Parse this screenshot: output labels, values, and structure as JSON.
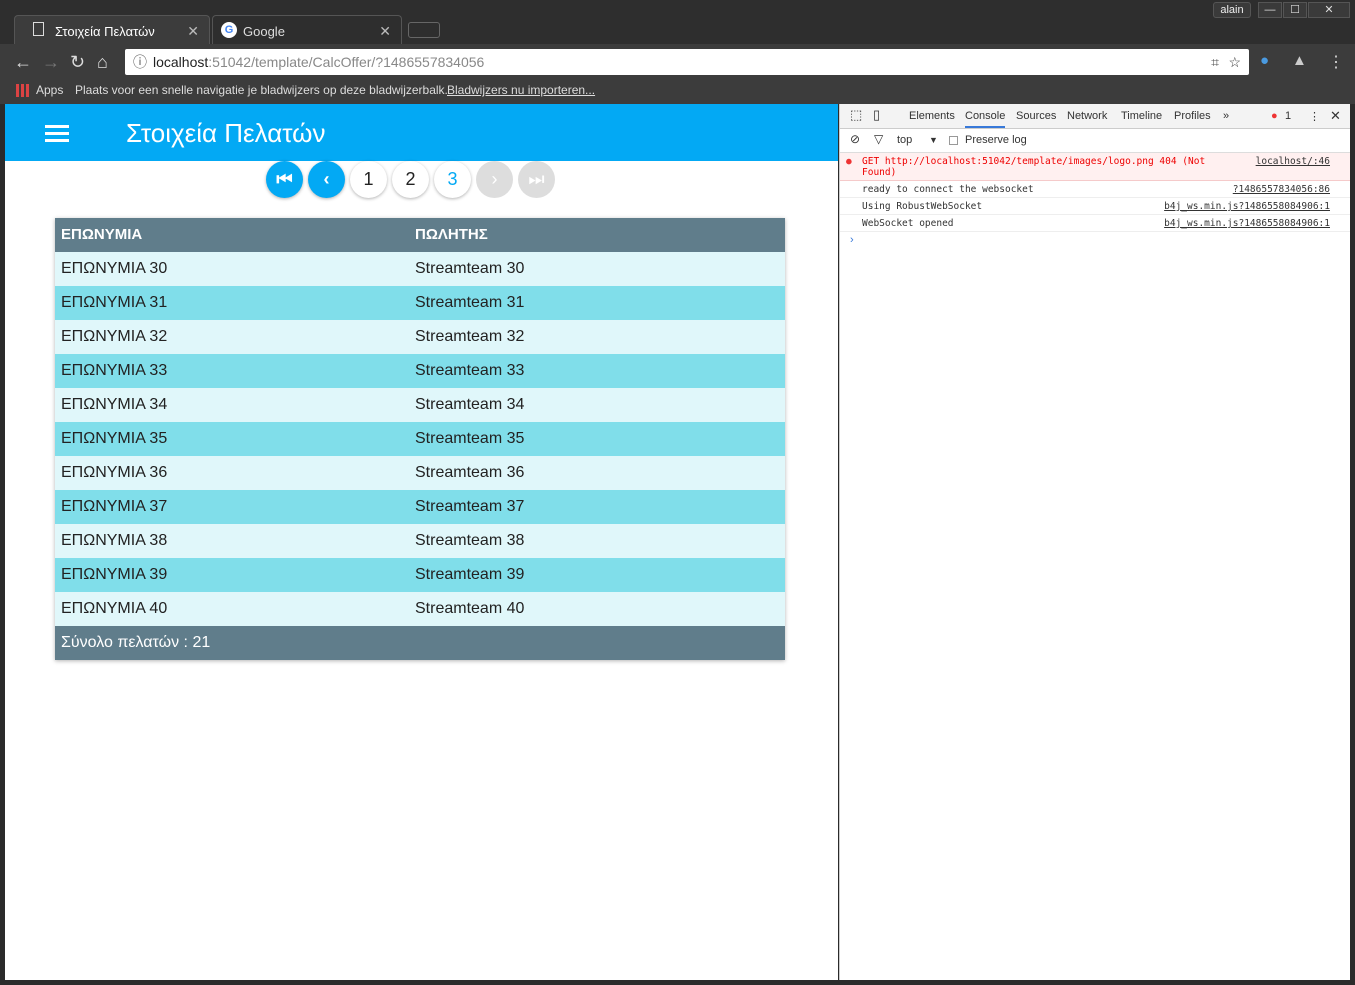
{
  "browser": {
    "tabs": [
      {
        "title": "Στοιχεία Πελατών",
        "icon": "page-icon"
      },
      {
        "title": "Google",
        "icon": "google-icon"
      }
    ],
    "user": "alain",
    "url_host": "localhost",
    "url_rest": ":51042/template/CalcOffer/?1486557834056",
    "bookmarks": {
      "apps": "Apps",
      "message": "Plaats voor een snelle navigatie je bladwijzers op deze bladwijzerbalk.",
      "import_link": "Bladwijzers nu importeren..."
    }
  },
  "app": {
    "title": "Στοιχεία Πελατών",
    "accent": "#03a9f4",
    "pagination": {
      "pages": [
        "1",
        "2",
        "3"
      ],
      "current": "3"
    },
    "table": {
      "headers": [
        "ΕΠΩΝΥΜΙΑ",
        "ΠΩΛΗΤΗΣ"
      ],
      "rows": [
        [
          "ΕΠΩΝΥΜΙΑ 30",
          "Streamteam 30"
        ],
        [
          "ΕΠΩΝΥΜΙΑ 31",
          "Streamteam 31"
        ],
        [
          "ΕΠΩΝΥΜΙΑ 32",
          "Streamteam 32"
        ],
        [
          "ΕΠΩΝΥΜΙΑ 33",
          "Streamteam 33"
        ],
        [
          "ΕΠΩΝΥΜΙΑ 34",
          "Streamteam 34"
        ],
        [
          "ΕΠΩΝΥΜΙΑ 35",
          "Streamteam 35"
        ],
        [
          "ΕΠΩΝΥΜΙΑ 36",
          "Streamteam 36"
        ],
        [
          "ΕΠΩΝΥΜΙΑ 37",
          "Streamteam 37"
        ],
        [
          "ΕΠΩΝΥΜΙΑ 38",
          "Streamteam 38"
        ],
        [
          "ΕΠΩΝΥΜΙΑ 39",
          "Streamteam 39"
        ],
        [
          "ΕΠΩΝΥΜΙΑ 40",
          "Streamteam 40"
        ]
      ],
      "footer": "Σύνολο πελατών : 21"
    }
  },
  "devtools": {
    "tabs": [
      "Elements",
      "Console",
      "Sources",
      "Network",
      "Timeline",
      "Profiles"
    ],
    "active_tab": "Console",
    "error_count": "1",
    "context": "top",
    "preserve_log": "Preserve log",
    "messages": [
      {
        "text": "GET http://localhost:51042/template/images/logo.png 404 (Not Found)",
        "source": "localhost/:46",
        "level": "error"
      },
      {
        "text": "ready to connect the websocket",
        "source": "?1486557834056:86"
      },
      {
        "text": "Using RobustWebSocket",
        "source": "b4j_ws.min.js?1486558084906:1"
      },
      {
        "text": "WebSocket opened",
        "source": "b4j_ws.min.js?1486558084906:1"
      }
    ]
  }
}
